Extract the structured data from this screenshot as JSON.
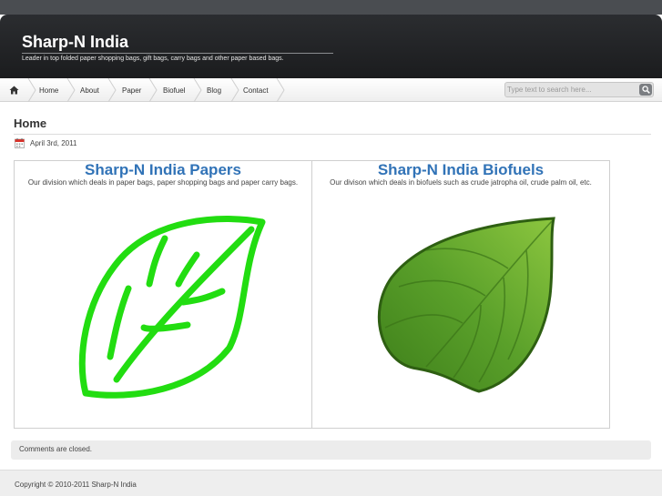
{
  "site": {
    "title": "Sharp-N India",
    "description": "Leader in top folded paper shopping bags, gift bags, carry bags and other paper based bags."
  },
  "nav": {
    "home_icon": "home-icon",
    "items": [
      {
        "label": "Home"
      },
      {
        "label": "About"
      },
      {
        "label": "Paper"
      },
      {
        "label": "Biofuel"
      },
      {
        "label": "Blog"
      },
      {
        "label": "Contact"
      }
    ]
  },
  "search": {
    "placeholder": "Type text to search here...",
    "button_icon": "search-icon"
  },
  "page": {
    "title": "Home",
    "date_icon": "calendar-icon",
    "date": "April 3rd, 2011"
  },
  "divisions": [
    {
      "title": "Sharp-N India Papers",
      "description": "Our division which deals in paper bags, paper shopping bags and paper carry bags.",
      "image_icon": "outline-leaf-icon",
      "color": "#22dd11"
    },
    {
      "title": "Sharp-N India Biofuels",
      "description": "Our divison which deals in biofuels such as crude jatropha oil, crude palm oil, etc.",
      "image_icon": "green-leaf-icon",
      "color": "#5aa02a"
    }
  ],
  "comments": {
    "status": "Comments are closed."
  },
  "footer": {
    "copyright": "Copyright © 2010-2011 Sharp-N India"
  }
}
